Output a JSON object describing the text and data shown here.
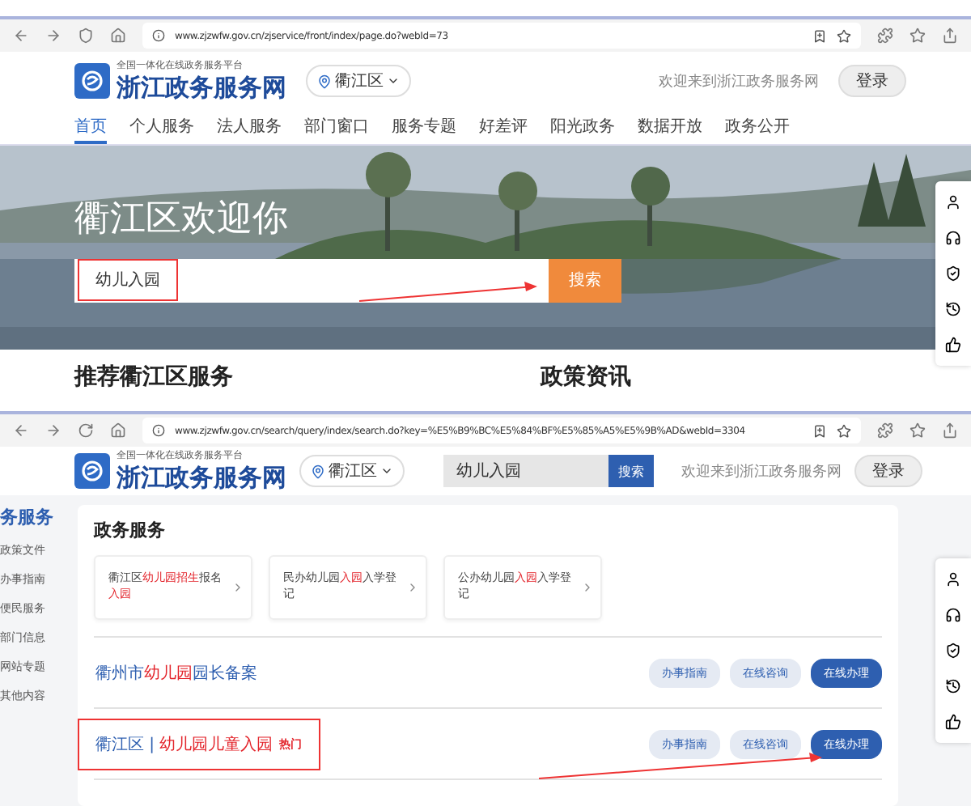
{
  "home_window": {
    "url": "www.zjzwfw.gov.cn/zjservice/front/index/page.do?webId=73",
    "logo": {
      "subtitle": "全国一体化在线政务服务平台",
      "title": "浙江政务服务网"
    },
    "location": "衢江区",
    "user_text": "欢迎来到浙江政务服务网",
    "login_button": "登录",
    "nav": [
      {
        "label": "首页",
        "selected": true
      },
      {
        "label": "个人服务",
        "selected": false
      },
      {
        "label": "法人服务",
        "selected": false
      },
      {
        "label": "部门窗口",
        "selected": false
      },
      {
        "label": "服务专题",
        "selected": false
      },
      {
        "label": "好差评",
        "selected": false
      },
      {
        "label": "阳光政务",
        "selected": false
      },
      {
        "label": "数据开放",
        "selected": false
      },
      {
        "label": "政务公开",
        "selected": false
      }
    ],
    "banner": {
      "title": "衢江区欢迎你",
      "search": {
        "value": "幼儿入园",
        "annotated": true,
        "button": "搜索"
      }
    },
    "sections": [
      "推荐衢江区服务",
      "政策资讯"
    ]
  },
  "search_window": {
    "url": "www.zjzwfw.gov.cn/search/query/index/search.do?key=%E5%B9%BC%E5%84%BF%E5%85%A5%E5%9B%AD&webId=3304",
    "logo": {
      "subtitle": "全国一体化在线政务服务平台",
      "title": "浙江政务服务网"
    },
    "location": "衢江区",
    "search": {
      "value": "幼儿入园",
      "button": "搜索"
    },
    "user_text": "欢迎来到浙江政务服务网",
    "login_button": "登录",
    "sidebar": {
      "title": "务服务",
      "items": [
        "政策文件",
        "办事指南",
        "便民服务",
        "部门信息",
        "网站专题",
        "其他内容"
      ]
    },
    "panel": {
      "title": "政务服务",
      "cards": [
        {
          "parts": [
            {
              "text": "衢江区",
              "highlight": false
            },
            {
              "text": "幼儿园招生",
              "highlight": true
            },
            {
              "text": "报名",
              "highlight": false
            },
            {
              "text": "入园",
              "highlight": true
            }
          ]
        },
        {
          "parts": [
            {
              "text": "民办幼儿园",
              "highlight": false
            },
            {
              "text": "入园",
              "highlight": true
            },
            {
              "text": "入学登记",
              "highlight": false
            }
          ]
        },
        {
          "parts": [
            {
              "text": "公办幼儿园",
              "highlight": false
            },
            {
              "text": "入园",
              "highlight": true
            },
            {
              "text": "入学登记",
              "highlight": false
            }
          ]
        }
      ],
      "results": [
        {
          "annotated": false,
          "parts": [
            {
              "text": "衢州市",
              "highlight": false
            },
            {
              "text": "幼儿园",
              "highlight": true
            },
            {
              "text": "园长备案",
              "highlight": false
            }
          ],
          "buttons": [
            {
              "label": "办事指南",
              "primary": false
            },
            {
              "label": "在线咨询",
              "primary": false
            },
            {
              "label": "在线办理",
              "primary": true
            }
          ]
        },
        {
          "annotated": true,
          "parts": [
            {
              "text": "衢江区 | ",
              "highlight": false
            },
            {
              "text": "幼儿园儿童入园",
              "highlight": true
            }
          ],
          "tag": "热门",
          "buttons": [
            {
              "label": "办事指南",
              "primary": false
            },
            {
              "label": "在线咨询",
              "primary": false
            },
            {
              "label": "在线办理",
              "primary": true
            }
          ]
        }
      ]
    }
  }
}
